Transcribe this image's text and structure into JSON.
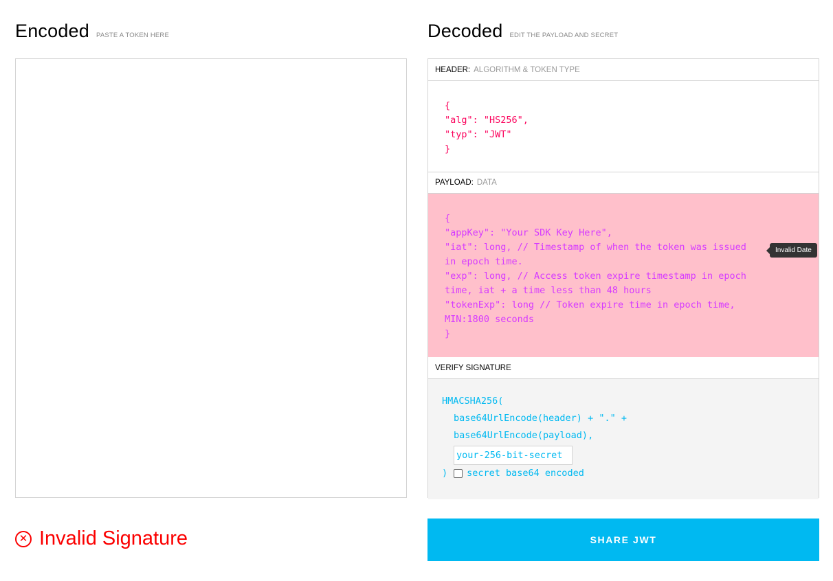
{
  "encoded": {
    "title": "Encoded",
    "subtitle": "PASTE A TOKEN HERE",
    "token_text": ""
  },
  "decoded": {
    "title": "Decoded",
    "subtitle": "EDIT THE PAYLOAD AND SECRET",
    "header": {
      "label": "HEADER:",
      "hint": "ALGORITHM & TOKEN TYPE",
      "code": "{\n\"alg\": \"HS256\",\n\"typ\": \"JWT\"\n}"
    },
    "payload": {
      "label": "PAYLOAD:",
      "hint": "DATA",
      "code": "{\n\"appKey\": \"Your SDK Key Here\",\n\"iat\": long, // Timestamp of when the token was issued\nin epoch time.\n\"exp\": long, // Access token expire timestamp in epoch\ntime, iat + a time less than 48 hours\n\"tokenExp\": long // Token expire time in epoch time,\nMIN:1800 seconds\n}",
      "tooltip": "Invalid Date"
    },
    "verify": {
      "label": "VERIFY SIGNATURE",
      "func": "HMACSHA256(",
      "line1": "base64UrlEncode(header) + \".\" +",
      "line2": "base64UrlEncode(payload),",
      "secret_value": "your-256-bit-secret",
      "close": ")",
      "checkbox_label": "secret base64 encoded",
      "checkbox_checked": false
    }
  },
  "status": {
    "icon": "close-circle-icon",
    "text": "Invalid Signature",
    "color": "#fb0000"
  },
  "share_button": {
    "label": "SHARE JWT",
    "color": "#00b9f1"
  },
  "colors": {
    "header_code": "#fb015b",
    "payload_code": "#d63aff",
    "payload_bg": "#ffc0cb",
    "signature_code": "#00b9f1"
  }
}
